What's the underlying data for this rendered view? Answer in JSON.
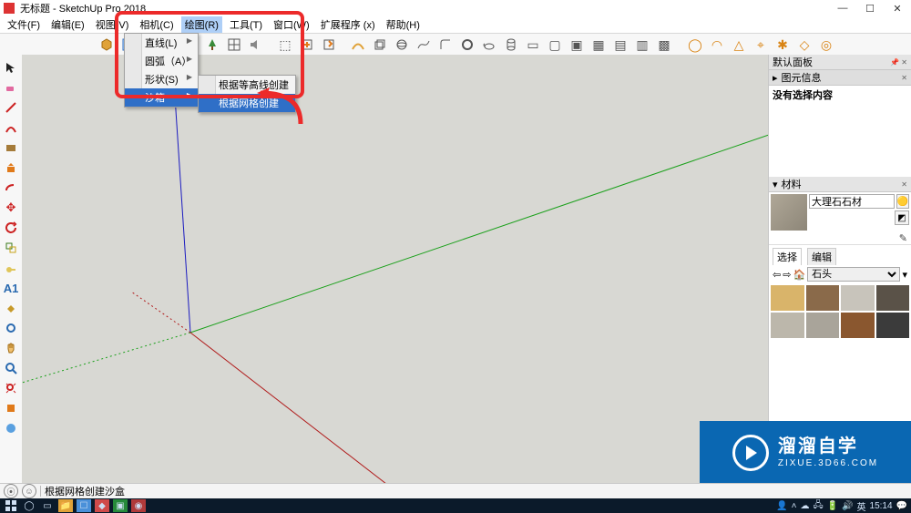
{
  "window": {
    "title": "无标题 - SketchUp Pro 2018",
    "min": "—",
    "max": "☐",
    "close": "✕"
  },
  "menus": {
    "file": "文件(F)",
    "edit": "编辑(E)",
    "view": "视图(V)",
    "camera": "相机(C)",
    "draw": "绘图(R)",
    "tools": "工具(T)",
    "window": "窗口(W)",
    "extensions": "扩展程序 (x)",
    "help": "帮助(H)"
  },
  "draw_menu": {
    "line": "直线(L)",
    "arc": "圆弧（A）",
    "shape": "形状(S)",
    "sandbox": "沙箱"
  },
  "sandbox_submenu": {
    "from_contours": "根据等高线创建",
    "from_scratch": "根据网格创建"
  },
  "panels": {
    "default_panel": "默认面板",
    "entity_info_collapsed": "图元信息",
    "no_selection": "没有选择内容",
    "materials_hdr": "材料",
    "material_name": "大理石石材",
    "tab_select": "选择",
    "tab_edit": "编辑",
    "category": "石头"
  },
  "swatch_colors": [
    "#d9b46a",
    "#8a6a4a",
    "#c8c4bb",
    "#5a5248",
    "#bcb7ab",
    "#a9a49a",
    "#8a572f",
    "#3b3b3b"
  ],
  "status": {
    "hint": "根据网格创建沙盒"
  },
  "taskbar": {
    "ime": "英",
    "time": "15:14"
  },
  "watermark": {
    "line1": "溜溜自学",
    "line2": "ZIXUE.3D66.COM"
  }
}
